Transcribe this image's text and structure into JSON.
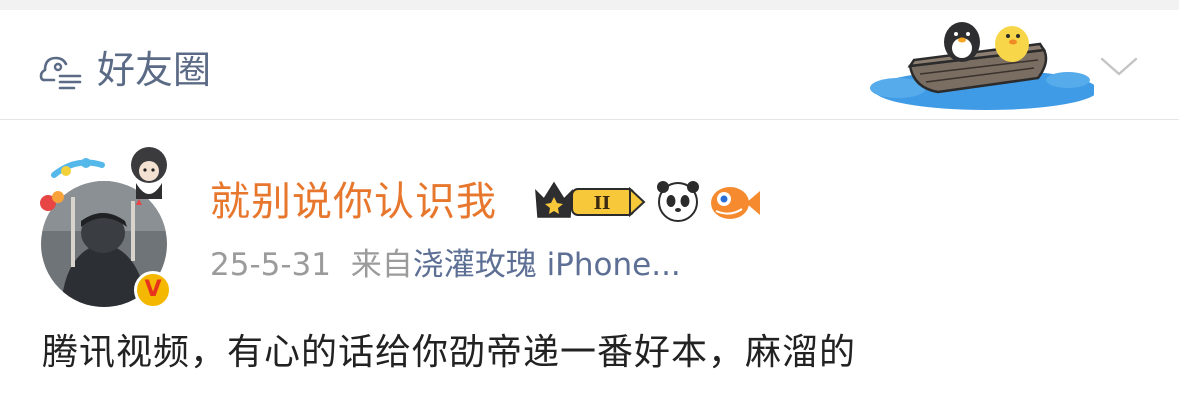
{
  "header": {
    "title": "好友圈",
    "icon": "friends-circle-icon",
    "illustration": "boat-illustration",
    "dropdown_icon": "chevron-down-icon"
  },
  "post": {
    "username": "就别说你认识我",
    "badges": [
      "crown-level-badge",
      "panda-badge",
      "fish-badge"
    ],
    "crown_level": "II",
    "verified_mark": "V",
    "date": "25-5-31",
    "source_prefix": "来自",
    "source": "浇灌玫瑰 iPhone...",
    "text": "腾讯视频，有心的话给你劭帝递一番好本，麻溜的"
  },
  "colors": {
    "header_text": "#5b6b86",
    "username": "#e8772e",
    "meta_gray": "#9b9b9b",
    "source_link": "#5d6f94",
    "body_text": "#222222",
    "verify_gold": "#f5b800"
  }
}
